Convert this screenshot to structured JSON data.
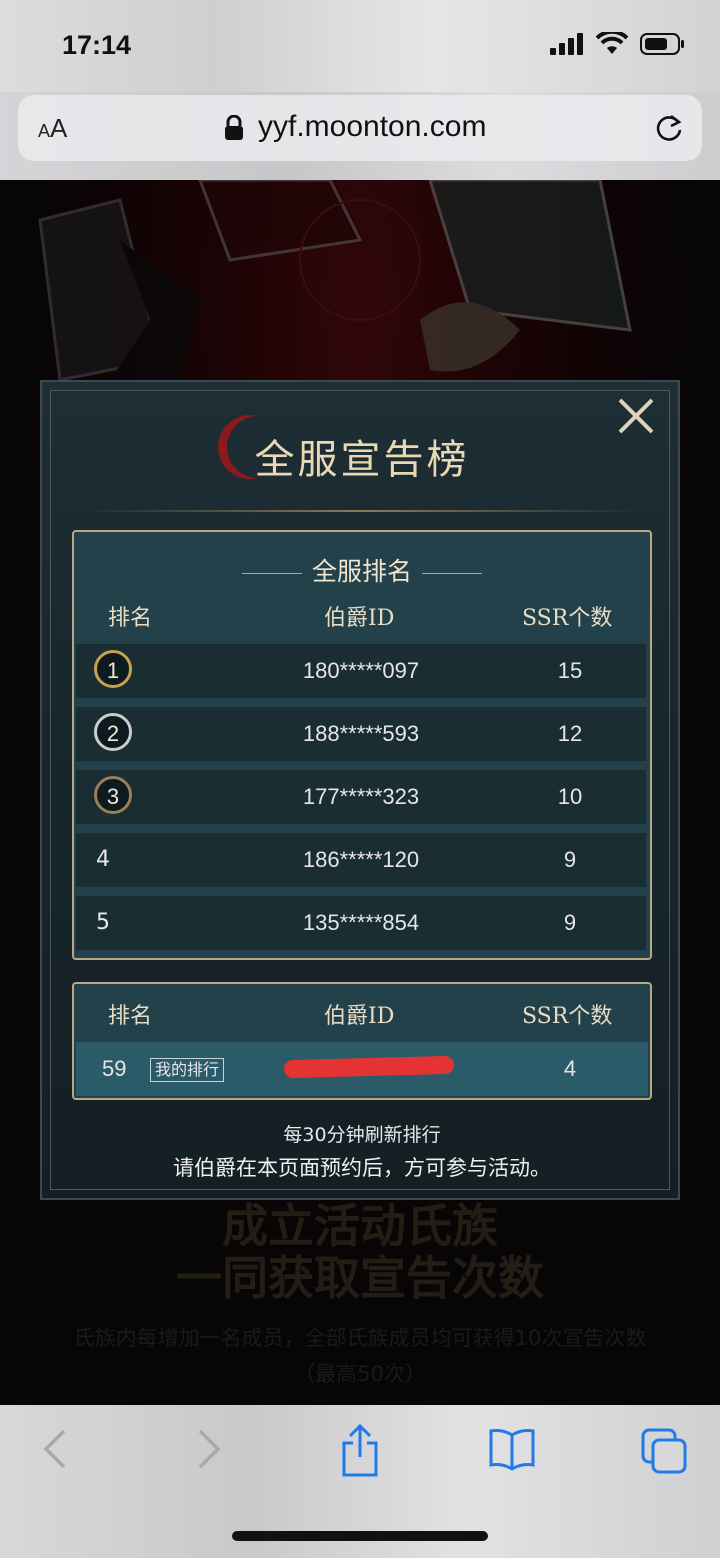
{
  "status_bar": {
    "time": "17:14"
  },
  "browser": {
    "text_size_label_small": "A",
    "text_size_label_large": "A",
    "url": "yyf.moonton.com"
  },
  "modal": {
    "title": "全服宣告榜",
    "section_title": "全服排名",
    "columns": {
      "rank": "排名",
      "id": "伯爵ID",
      "ssr": "SSR个数"
    },
    "rows": [
      {
        "rank": "1",
        "id": "180*****097",
        "ssr": "15"
      },
      {
        "rank": "2",
        "id": "188*****593",
        "ssr": "12"
      },
      {
        "rank": "3",
        "id": "177*****323",
        "ssr": "10"
      },
      {
        "rank": "4",
        "id": "186*****120",
        "ssr": "9"
      },
      {
        "rank": "5",
        "id": "135*****854",
        "ssr": "9"
      }
    ],
    "my": {
      "rank": "59",
      "tag": "我的排行",
      "ssr": "4"
    },
    "refresh_note": "每30分钟刷新排行",
    "participate_note": "请伯爵在本页面预约后，方可参与活动。"
  },
  "background_section": {
    "heading_line1": "成立活动氏族",
    "heading_line2": "一同获取宣告次数",
    "description": "氏族内每增加一名成员，全部氏族成员均可获得10次宣告次数 （最高50次）"
  },
  "colors": {
    "accent_gold": "#b9a982",
    "panel": "#22414b",
    "my_row": "#2b5a69",
    "redaction": "#e53333"
  }
}
